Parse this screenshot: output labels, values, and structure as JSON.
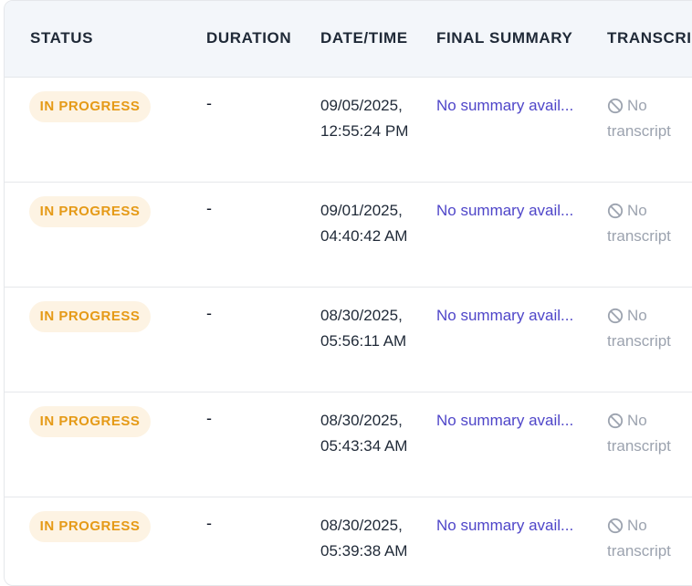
{
  "table": {
    "columns": {
      "status": "STATUS",
      "duration": "DURATION",
      "datetime": "DATE/TIME",
      "final_summary": "FINAL SUMMARY",
      "transcript": "TRANSCRI"
    },
    "rows": [
      {
        "status": "IN PROGRESS",
        "duration": "-",
        "date": "09/05/2025,",
        "time": "12:55:24 PM",
        "summary": "No summary avail...",
        "transcript_line1": "No",
        "transcript_line2": "transcript"
      },
      {
        "status": "IN PROGRESS",
        "duration": "-",
        "date": "09/01/2025,",
        "time": "04:40:42 AM",
        "summary": "No summary avail...",
        "transcript_line1": "No",
        "transcript_line2": "transcript"
      },
      {
        "status": "IN PROGRESS",
        "duration": "-",
        "date": "08/30/2025,",
        "time": "05:56:11 AM",
        "summary": "No summary avail...",
        "transcript_line1": "No",
        "transcript_line2": "transcript"
      },
      {
        "status": "IN PROGRESS",
        "duration": "-",
        "date": "08/30/2025,",
        "time": "05:43:34 AM",
        "summary": "No summary avail...",
        "transcript_line1": "No",
        "transcript_line2": "transcript"
      },
      {
        "status": "IN PROGRESS",
        "duration": "-",
        "date": "08/30/2025,",
        "time": "05:39:38 AM",
        "summary": "No summary avail...",
        "transcript_line1": "No",
        "transcript_line2": "transcript"
      }
    ]
  },
  "icons": {
    "no_transcript": "ban-icon"
  },
  "colors": {
    "header_bg": "#f3f6fa",
    "badge_bg": "#fdf3e3",
    "badge_text": "#e59a17",
    "summary_link": "#4f46c9",
    "muted": "#9ca3af"
  }
}
